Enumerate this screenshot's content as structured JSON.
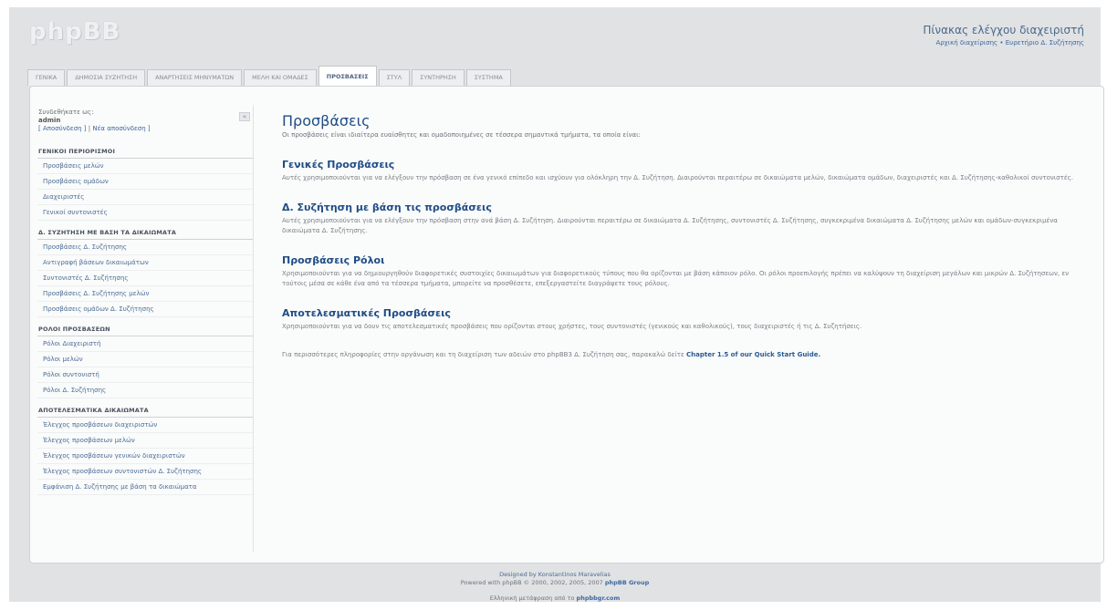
{
  "logo": "phpBB",
  "header": {
    "title": "Πίνακας ελέγχου διαχειριστή",
    "link1": "Αρχική διαχείρισης",
    "separator": "•",
    "link2": "Ευρετήριο Δ. Συζήτησης"
  },
  "tabs": [
    {
      "label": "ΓΕΝΙΚΑ"
    },
    {
      "label": "ΔΗΜΟΣΙΑ ΣΥΖΗΤΗΣΗ"
    },
    {
      "label": "ΑΝΑΡΤΗΣΕΙΣ ΜΗΝΥΜΑΤΩΝ"
    },
    {
      "label": "ΜΕΛΗ ΚΑΙ ΟΜΑΔΕΣ"
    },
    {
      "label": "ΠΡΟΣΒΑΣΕΙΣ"
    },
    {
      "label": "ΣΤΥΛ"
    },
    {
      "label": "ΣΥΝΤΗΡΗΣΗ"
    },
    {
      "label": "ΣΥΣΤΗΜΑ"
    }
  ],
  "user": {
    "logged_as": "Συνδεθήκατε ως:",
    "username": "admin",
    "logout": "[ Αποσύνδεση ]",
    "sep": "|",
    "reauth": "Νέα αποσύνδεση ]"
  },
  "collapse_label": "«",
  "menu": [
    {
      "head": "ΓΕΝΙΚΟΙ ΠΕΡΙΟΡΙΣΜΟΙ",
      "items": [
        "Προσβάσεις μελών",
        "Προσβάσεις ομάδων",
        "Διαχειριστές",
        "Γενικοί συντονιστές"
      ]
    },
    {
      "head": "Δ. ΣΥΖΗΤΗΣΗ ΜΕ ΒΑΣΗ ΤΑ ΔΙΚΑΙΩΜΑΤΑ",
      "items": [
        "Προσβάσεις Δ. Συζήτησης",
        "Αντιγραφή βάσεων δικαιωμάτων",
        "Συντονιστές Δ. Συζήτησης",
        "Προσβάσεις Δ. Συζήτησης μελών",
        "Προσβάσεις ομάδων Δ. Συζήτησης"
      ]
    },
    {
      "head": "ΡΟΛΟΙ ΠΡΟΣΒΑΣΕΩΝ",
      "items": [
        "Ρόλοι Διαχειριστή",
        "Ρόλοι μελών",
        "Ρόλοι συντονιστή",
        "Ρόλοι Δ. Συζήτησης"
      ]
    },
    {
      "head": "ΑΠΟΤΕΛΕΣΜΑΤΙΚΑ ΔΙΚΑΙΩΜΑΤΑ",
      "items": [
        "Έλεγχος προσβάσεων διαχειριστών",
        "Έλεγχος προσβάσεων μελών",
        "Έλεγχος προσβάσεων γενικών διαχειριστών",
        "Έλεγχος προσβάσεων συντονιστών Δ. Συζήτησης",
        "Εμφάνιση Δ. Συζήτησης με βάση τα δικαιώματα"
      ]
    }
  ],
  "content": {
    "title": "Προσβάσεις",
    "intro": "Οι προσβάσεις είναι ιδιαίτερα ευαίσθητες και ομαδοποιημένες σε τέσσερα σημαντικά τμήματα, τα οποία είναι:",
    "sections": [
      {
        "title": "Γενικές Προσβάσεις",
        "text": "Αυτές χρησιμοποιούνται για να ελέγξουν την πρόσβαση σε ένα γενικό επίπεδο και ισχύουν για ολόκληρη την Δ. Συζήτηση. Διαιρούνται περαιτέρω σε δικαιώματα μελών, δικαιώματα ομάδων, διαχειριστές και Δ. Συζήτησης-καθολικοί συντονιστές."
      },
      {
        "title": "Δ. Συζήτηση με βάση τις προσβάσεις",
        "text": "Αυτές χρησιμοποιούνται για να ελέγξουν την πρόσβαση στην ανά βάση Δ. Συζήτηση. Διαιρούνται περαιτέρω σε δικαιώματα Δ. Συζήτησης, συντονιστές Δ. Συζήτησης, συγκεκριμένα δικαιώματα Δ. Συζήτησης μελών και ομάδων-συγκεκριμένα δικαιώματα Δ. Συζήτησης."
      },
      {
        "title": "Προσβάσεις Ρόλοι",
        "text": "Χρησιμοποιούνται για να δημιουργηθούν διαφορετικές συστοιχίες δικαιωμάτων για διαφορετικούς τύπους που θα ορίζονται με βάση κάποιον ρόλο. Οι ρόλοι προεπιλογής πρέπει να καλύψουν τη διαχείριση μεγάλων και μικρών Δ. Συζήτησεων, εν τούτοις μέσα σε κάθε ένα από τα τέσσερα τμήματα, μπορείτε να προσθέσετε, επεξεργαστείτε διαγράψετε τους ρόλους."
      },
      {
        "title": "Αποτελεσματικές Προσβάσεις",
        "text": "Χρησιμοποιούνται για να δουν τις αποτελεσματικές προσβάσεις που ορίζονται στους χρήστες, τους συντονιστές (γενικούς και καθολικούς), τους διαχειριστές ή τις Δ. Συζητήσεις."
      }
    ],
    "footer_text": "Για περισσότερες πληροφορίες στην οργάνωση και τη διαχείριση των αδειών στο phpBB3 Δ. Συζήτηση σας, παρακαλώ δείτε",
    "footer_link": "Chapter 1.5 of our Quick Start Guide."
  },
  "footer": {
    "designed": "Designed by Konstantinos Maravelias",
    "powered": "Powered with phpBB © 2000, 2002, 2005, 2007",
    "group": "phpBB Group",
    "translation_prefix": "Ελληνική μετάφραση από το",
    "translation_link": "phpbbgr.com"
  }
}
